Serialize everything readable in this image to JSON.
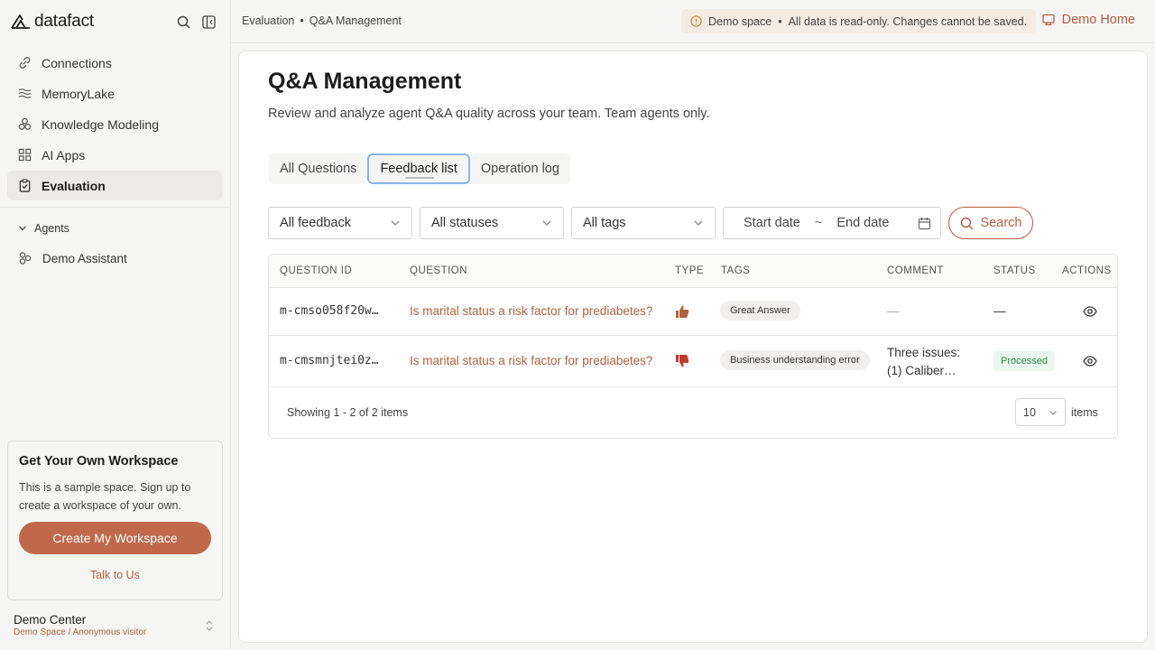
{
  "app": {
    "name": "datafact"
  },
  "sidebar": {
    "items": [
      {
        "label": "Connections",
        "icon": "link-icon"
      },
      {
        "label": "MemoryLake",
        "icon": "waves-icon"
      },
      {
        "label": "Knowledge Modeling",
        "icon": "cubes-icon"
      },
      {
        "label": "AI Apps",
        "icon": "grid-icon"
      },
      {
        "label": "Evaluation",
        "icon": "clipboard-check-icon",
        "active": true
      }
    ],
    "agents_header": "Agents",
    "agents": [
      {
        "label": "Demo Assistant",
        "icon": "agent-icon"
      }
    ],
    "promo": {
      "title": "Get Your Own Workspace",
      "text": "This is a sample space. Sign up to create a workspace of your own.",
      "button": "Create My Workspace",
      "link": "Talk to Us"
    },
    "user": {
      "name": "Demo Center",
      "sub": "Demo Space / Anonymous visitor"
    }
  },
  "topbar": {
    "breadcrumb": [
      "Evaluation",
      "•",
      "Q&A Management"
    ],
    "notice": {
      "label": "Demo space",
      "sep": "•",
      "text": "All data is read-only. Changes cannot be saved."
    },
    "demo_home": "Demo Home"
  },
  "page": {
    "title": "Q&A Management",
    "description": "Review and analyze agent Q&A quality across your team. Team agents only."
  },
  "tabs": [
    {
      "label": "All Questions"
    },
    {
      "label": "Feedback list",
      "active": true
    },
    {
      "label": "Operation log"
    }
  ],
  "filters": {
    "feedback": "All feedback",
    "statuses": "All statuses",
    "tags": "All tags",
    "start_date": "Start date",
    "tilde": "~",
    "end_date": "End date",
    "search": "Search"
  },
  "table": {
    "columns": [
      "QUESTION ID",
      "QUESTION",
      "TYPE",
      "TAGS",
      "COMMENT",
      "STATUS",
      "ACTIONS"
    ],
    "rows": [
      {
        "id": "m-cmso058f20w…",
        "question": "Is marital status a risk factor for prediabetes?",
        "type": "thumbs-up",
        "tag": "Great Answer",
        "comment": "—",
        "status": "—"
      },
      {
        "id": "m-cmsmnjtei0z…",
        "question": "Is marital status a risk factor for prediabetes?",
        "type": "thumbs-down",
        "tag": "Business understanding error",
        "comment_line1": "Three issues:",
        "comment_line2": "(1) Caliber…",
        "status": "Processed"
      }
    ]
  },
  "pagination": {
    "showing": "Showing 1 - 2 of 2 items",
    "page_size": "10",
    "items_label": "items"
  },
  "colors": {
    "accent": "#b75d3e",
    "thumb_up": "#b3603f",
    "thumb_down": "#c0392b",
    "processed": "#2f8a52"
  }
}
